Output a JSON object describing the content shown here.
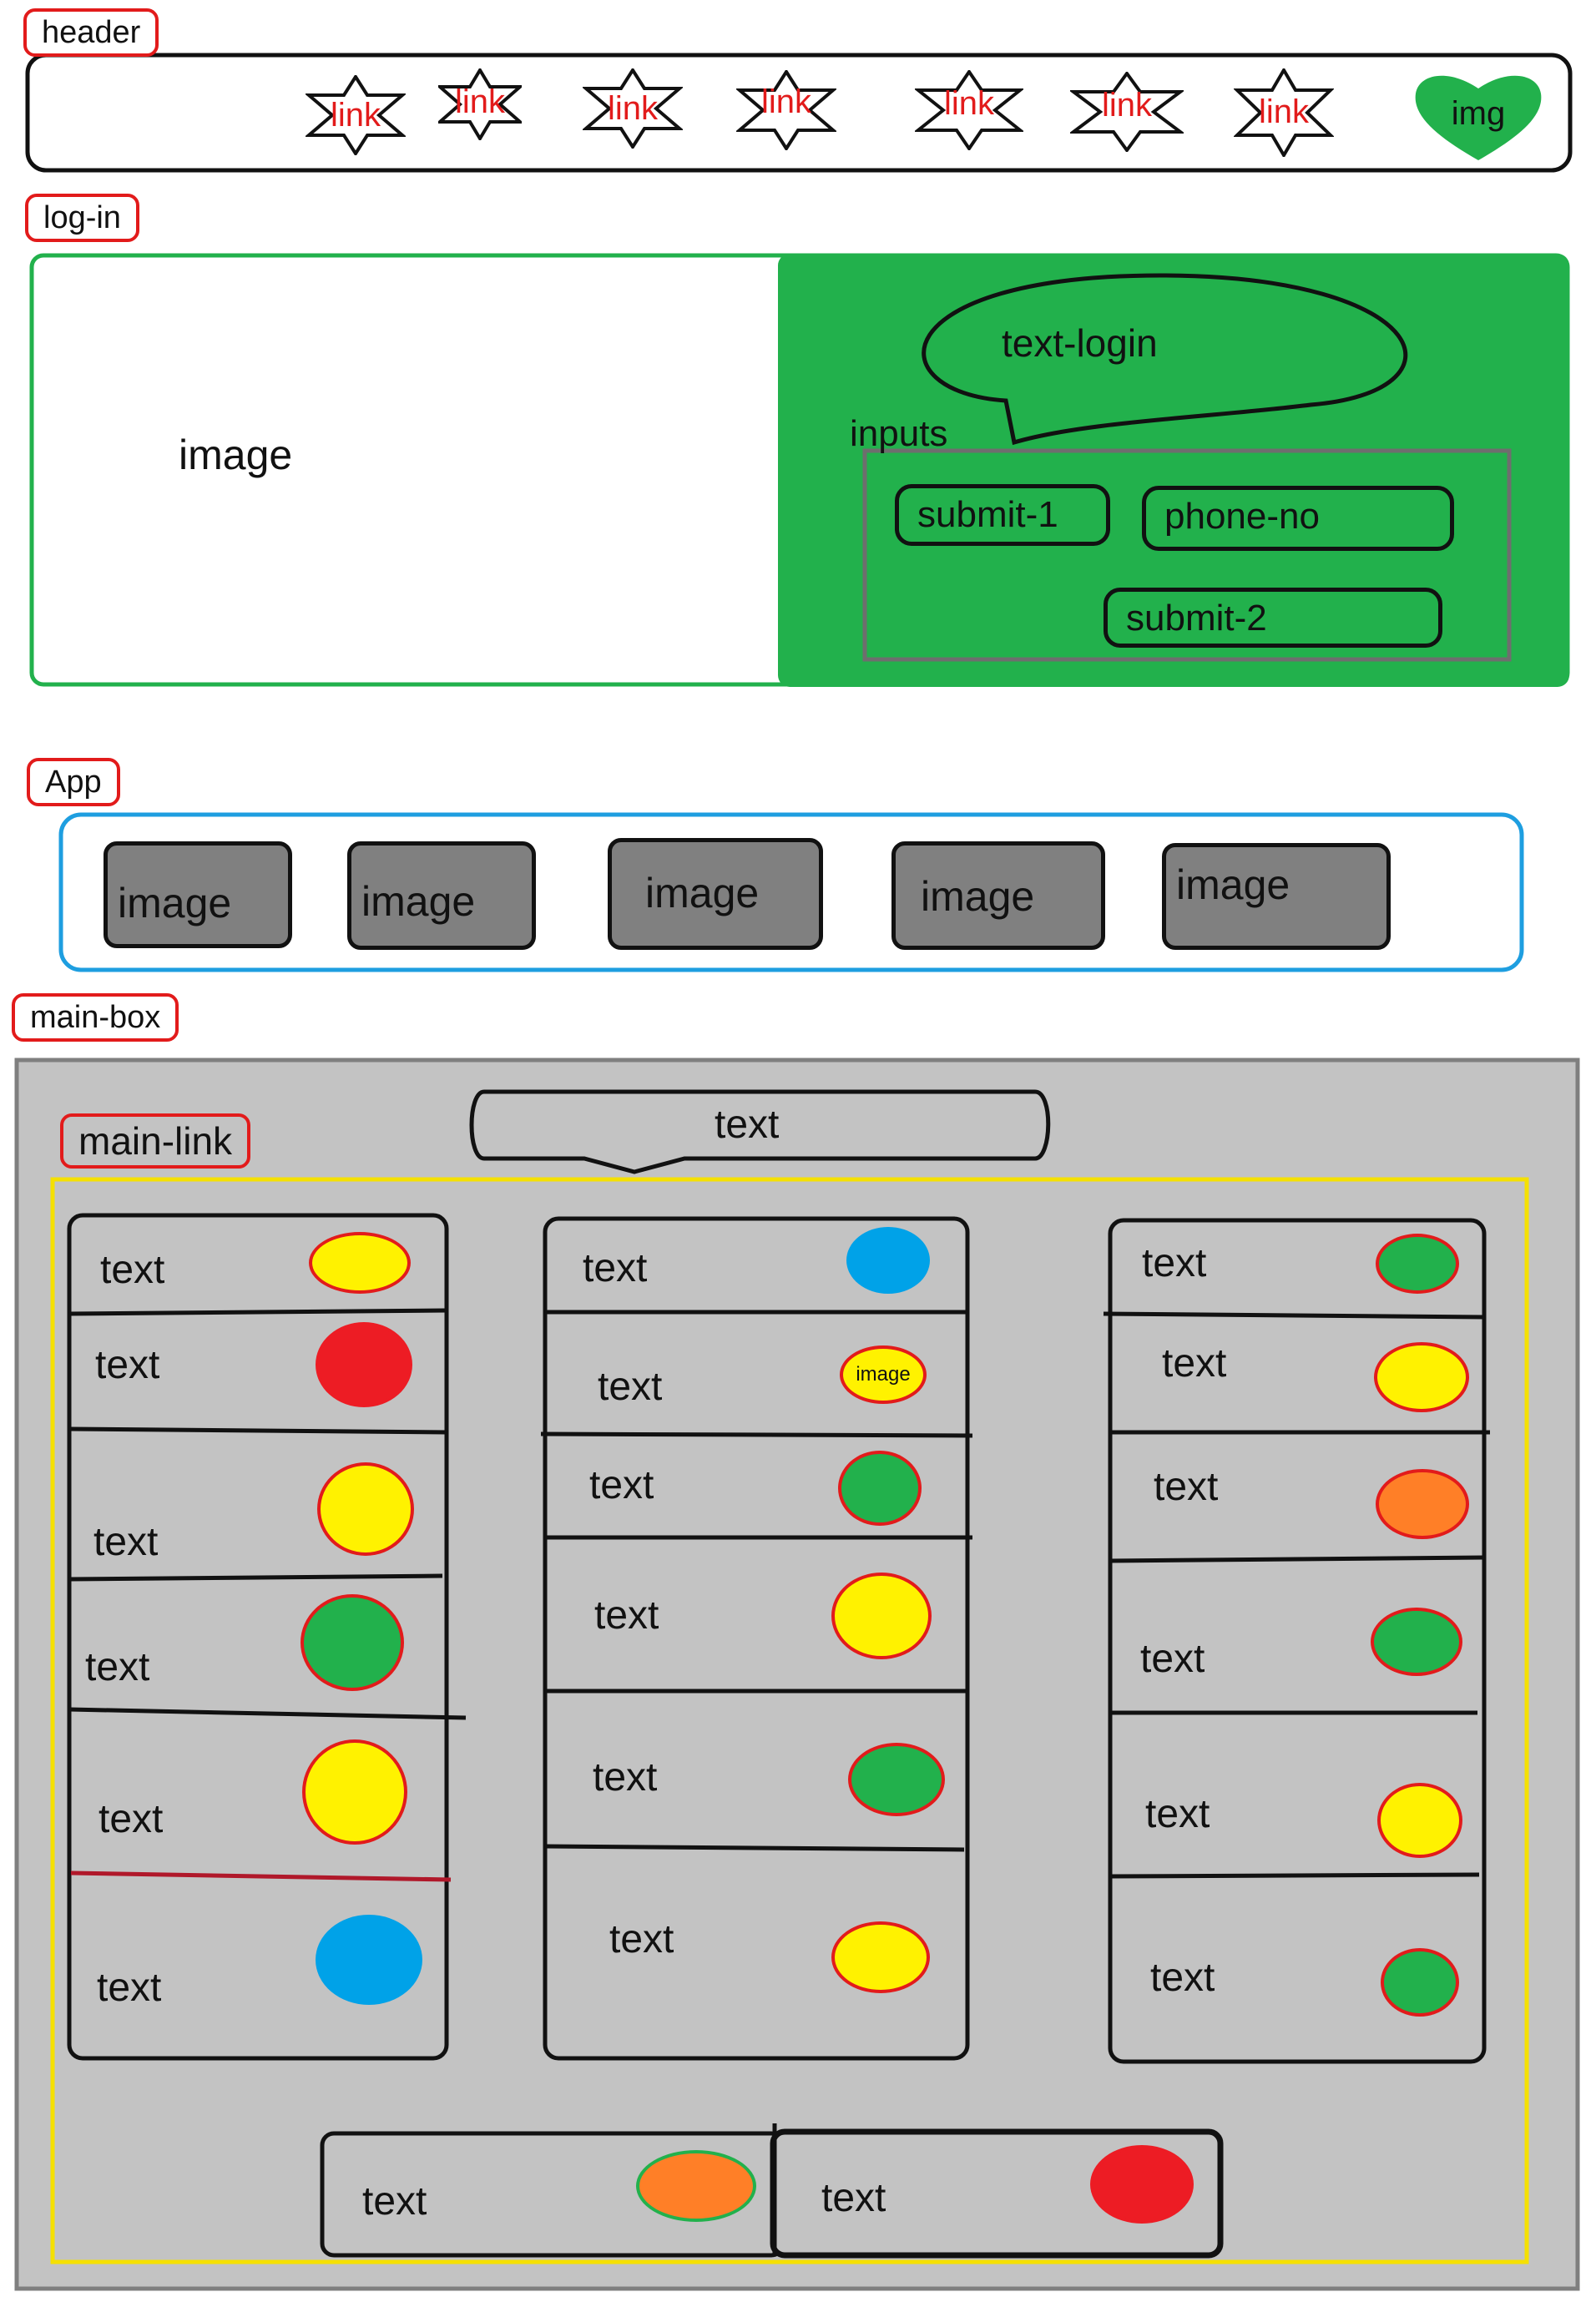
{
  "sections": {
    "header": "header",
    "login": "log-in",
    "app": "App",
    "main_box": "main-box",
    "main_link": "main-link"
  },
  "header": {
    "links": [
      "link",
      "link",
      "link",
      "link",
      "link",
      "link",
      "link"
    ],
    "img_label": "img",
    "img_color": "#22b14c"
  },
  "login": {
    "image_label": "image",
    "panel_color": "#22b14c",
    "bubble_text": "text-login",
    "inputs_label": "inputs",
    "submit1": "submit-1",
    "phone": "phone-no",
    "submit2": "submit-2"
  },
  "app": {
    "tiles": [
      "image",
      "image",
      "image",
      "image",
      "image"
    ]
  },
  "main": {
    "banner_text": "text",
    "col1": [
      {
        "text": "text",
        "color": "yellow"
      },
      {
        "text": "text",
        "color": "red"
      },
      {
        "text": "text",
        "color": "yellow"
      },
      {
        "text": "text",
        "color": "green"
      },
      {
        "text": "text",
        "color": "yellow"
      },
      {
        "text": "text",
        "color": "blue"
      }
    ],
    "col2": [
      {
        "text": "text",
        "color": "blue"
      },
      {
        "text": "text",
        "color": "yellow",
        "inner": "image"
      },
      {
        "text": "text",
        "color": "green"
      },
      {
        "text": "text",
        "color": "yellow"
      },
      {
        "text": "text",
        "color": "green"
      },
      {
        "text": "text",
        "color": "yellow"
      }
    ],
    "col3": [
      {
        "text": "text",
        "color": "green"
      },
      {
        "text": "text",
        "color": "yellow"
      },
      {
        "text": "text",
        "color": "orange"
      },
      {
        "text": "text",
        "color": "green"
      },
      {
        "text": "text",
        "color": "yellow"
      },
      {
        "text": "text",
        "color": "green"
      }
    ],
    "bottom": [
      {
        "text": "text",
        "color": "orange"
      },
      {
        "text": "text",
        "color": "red"
      }
    ]
  },
  "colors": {
    "yellow": "#fff200",
    "red": "#ed1c24",
    "green": "#22b14c",
    "blue": "#00a2e8",
    "orange": "#ff7f27",
    "outline_red": "#e21b1b",
    "outline_blue": "#1e9ee0",
    "outline_yellow": "#f5e000",
    "panel_grey": "#c3c3c3",
    "tile_grey": "#808080"
  }
}
